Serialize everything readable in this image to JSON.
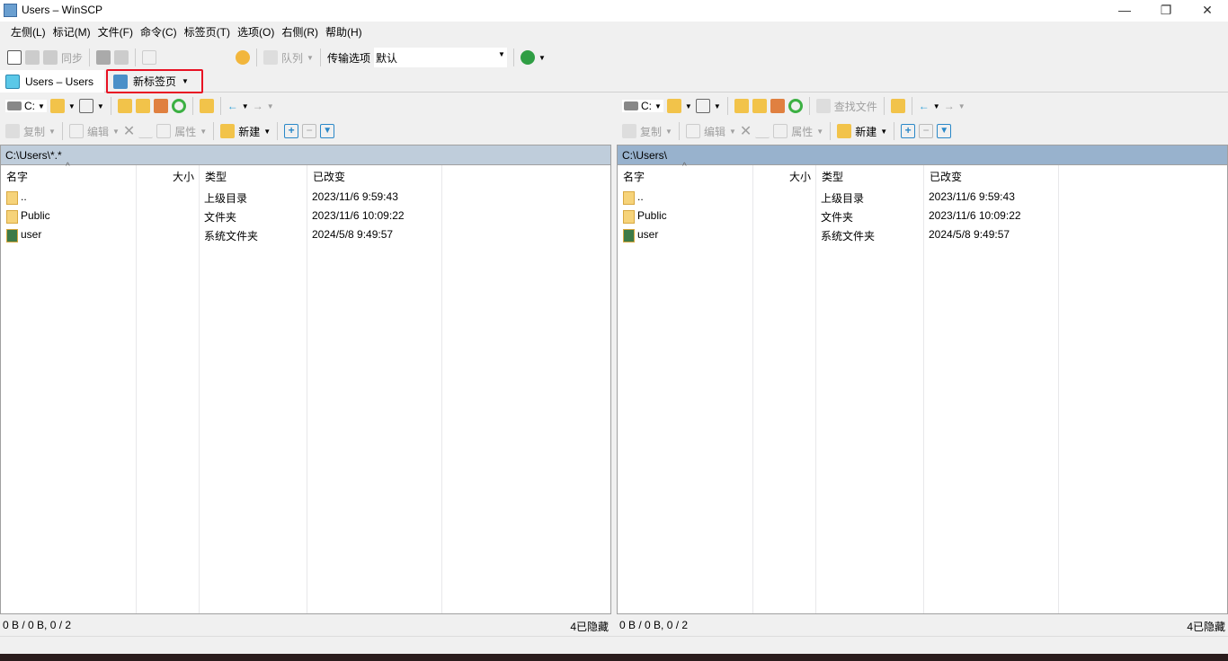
{
  "window": {
    "title": "Users – WinSCP",
    "min": "—",
    "restore": "❐",
    "close": "✕"
  },
  "menu": [
    "左侧(L)",
    "标记(M)",
    "文件(F)",
    "命令(C)",
    "标签页(T)",
    "选项(O)",
    "右侧(R)",
    "帮助(H)"
  ],
  "toolbar": {
    "sync": "同步",
    "queue": "队列",
    "transfer_label": "传输选项",
    "transfer_value": "默认"
  },
  "tabs": [
    {
      "label": "Users – Users"
    },
    {
      "label": "新标签页"
    }
  ],
  "colors": {
    "path_left": "#bfcddb",
    "path_right": "#98b2cd",
    "highlight": "#e81123"
  },
  "panels": [
    {
      "drive": "C:",
      "path": "C:\\Users\\*.*",
      "find": "",
      "status_left": "0 B / 0 B,  0 / 2",
      "status_right": "4已隐藏"
    },
    {
      "drive": "C:",
      "path": "C:\\Users\\",
      "find": "查找文件",
      "status_left": "0 B / 0 B,  0 / 2",
      "status_right": "4已隐藏"
    }
  ],
  "panel_toolbar": {
    "copy": "复制",
    "edit": "编辑",
    "props": "属性",
    "new": "新建"
  },
  "columns": [
    "名字",
    "大小",
    "类型",
    "已改变"
  ],
  "files": [
    {
      "name": "..",
      "size": "",
      "type": "上级目录",
      "changed": "2023/11/6 9:59:43",
      "icon": "parent-dir-icon"
    },
    {
      "name": "Public",
      "size": "",
      "type": "文件夹",
      "changed": "2023/11/6 10:09:22",
      "icon": "folder-icon"
    },
    {
      "name": "user",
      "size": "",
      "type": "系统文件夹",
      "changed": "2024/5/8 9:49:57",
      "icon": "user-folder-icon"
    }
  ]
}
